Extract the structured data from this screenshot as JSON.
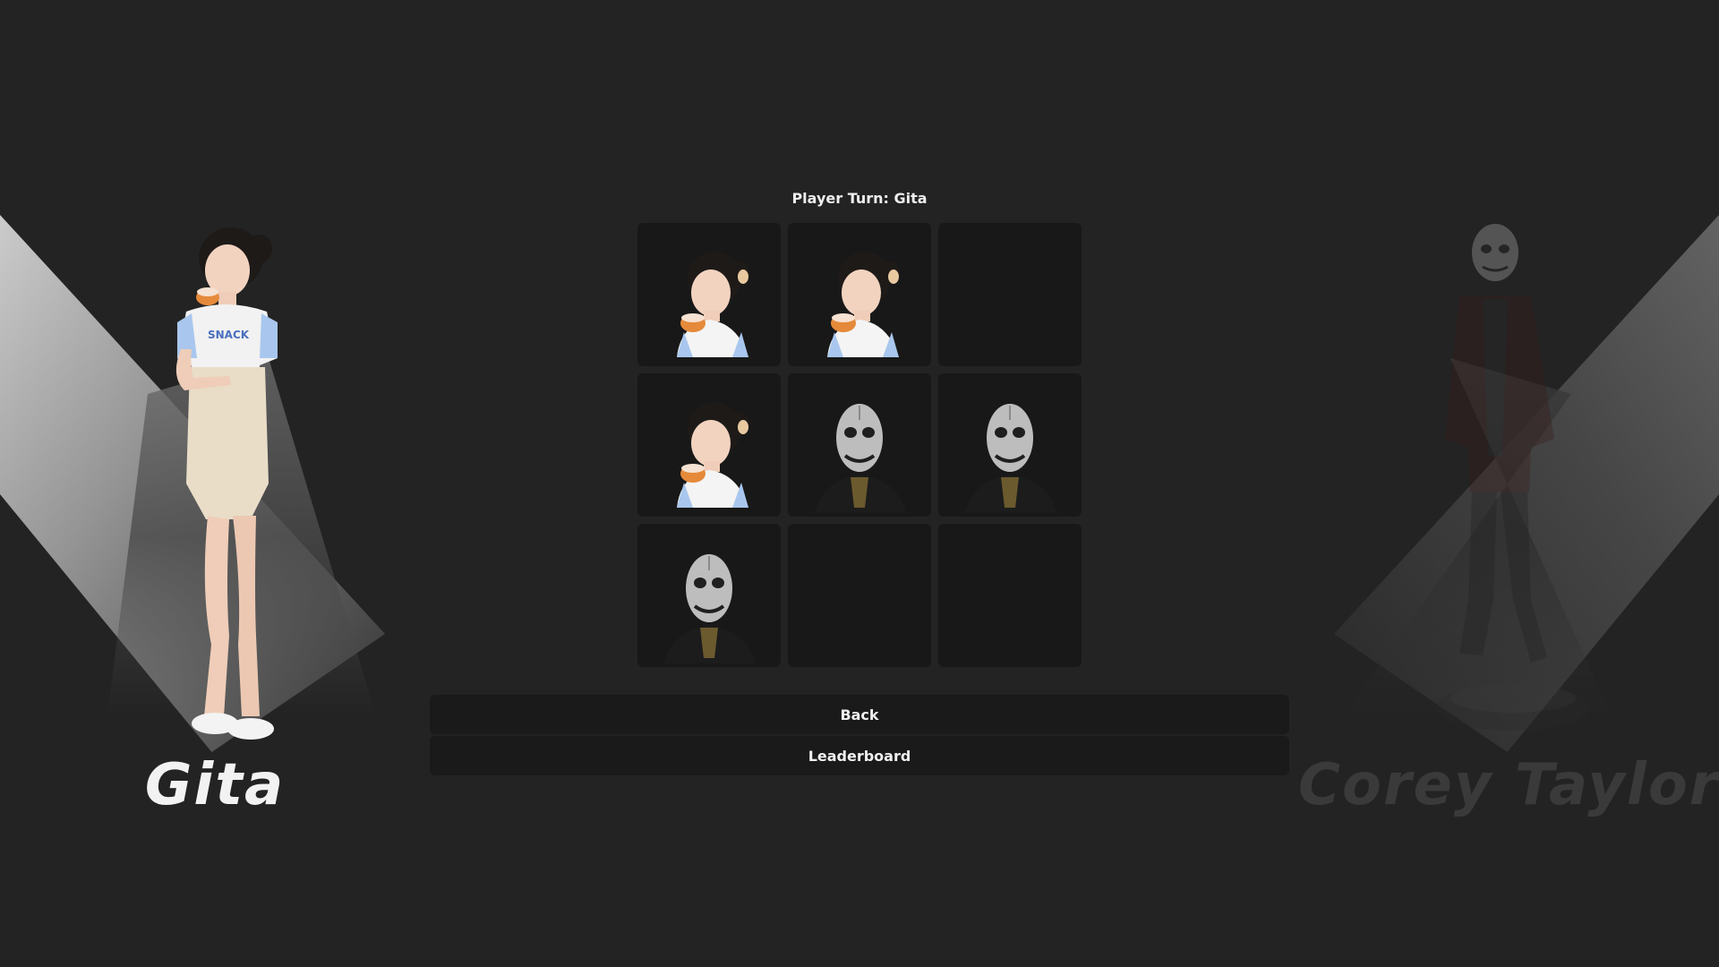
{
  "game": {
    "turn_label": "Player Turn: Gita",
    "player_one": {
      "name": "Gita",
      "marker": "gita-avatar"
    },
    "player_two": {
      "name": "Corey Taylor",
      "marker": "corey-mask-avatar"
    }
  },
  "board": {
    "cells": [
      "gita",
      "gita",
      "",
      "gita",
      "corey",
      "corey",
      "corey",
      "",
      ""
    ]
  },
  "buttons": {
    "back_label": "Back",
    "leaderboard_label": "Leaderboard"
  }
}
